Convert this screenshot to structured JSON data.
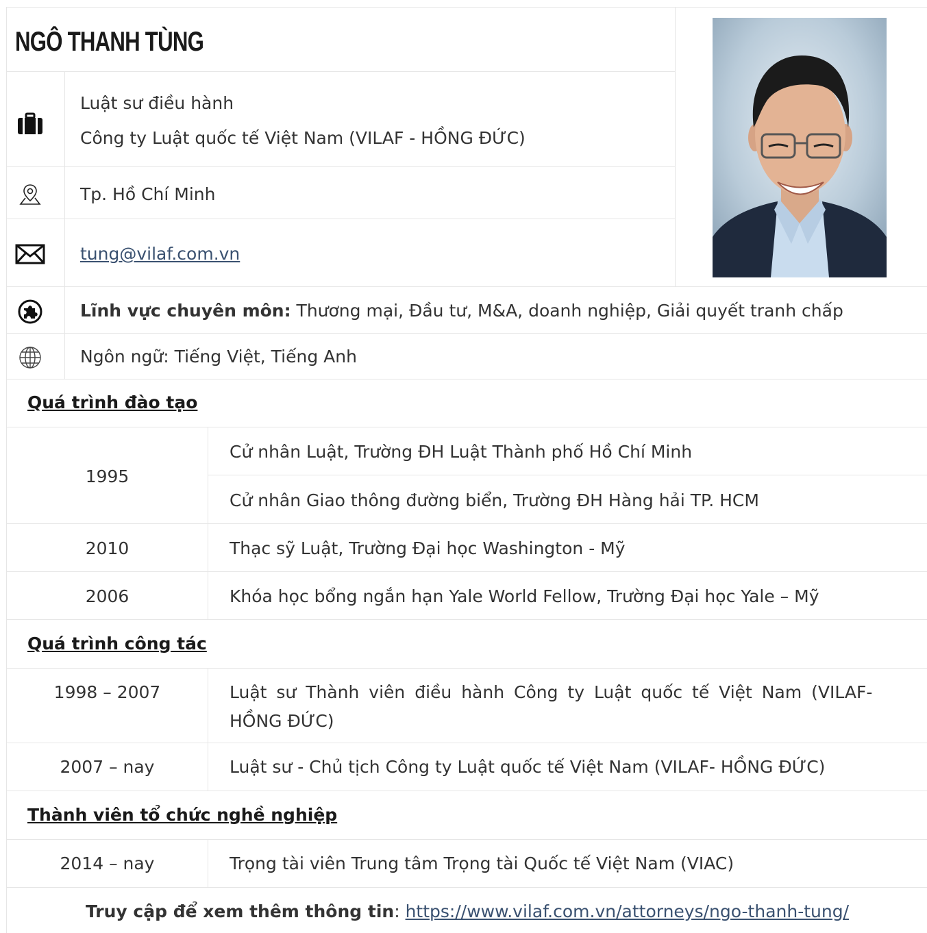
{
  "profile": {
    "name": "NGÔ THANH TÙNG",
    "position": "Luật sư điều hành",
    "company": "Công ty Luật quốc tế Việt Nam (VILAF - HỒNG ĐỨC)",
    "location": "Tp. Hồ Chí Minh",
    "email": "tung@vilaf.com.vn",
    "expertise_label": "Lĩnh vực chuyên môn:",
    "expertise_value": " Thương mại, Đầu tư, M&A, doanh nghiệp, Giải quyết tranh chấp",
    "languages": "Ngôn ngữ: Tiếng Việt, Tiếng Anh"
  },
  "icons": {
    "briefcase": "briefcase-icon",
    "location": "location-pin-icon",
    "email": "envelope-icon",
    "expertise": "puzzle-icon",
    "language": "globe-icon"
  },
  "education": {
    "title": "Quá trình đào tạo",
    "rows": [
      {
        "year": "1995",
        "items": [
          "Cử nhân Luật, Trường ĐH Luật Thành phố Hồ Chí Minh",
          "Cử nhân Giao thông đường biển, Trường ĐH Hàng hải TP. HCM"
        ]
      },
      {
        "year": "2010",
        "items": [
          "Thạc sỹ Luật, Trường Đại học Washington - Mỹ"
        ]
      },
      {
        "year": "2006",
        "items": [
          "Khóa học bổng ngắn hạn Yale World Fellow, Trường Đại học Yale – Mỹ"
        ]
      }
    ]
  },
  "work": {
    "title": "Quá trình công tác",
    "rows": [
      {
        "year": "1998 – 2007",
        "line1": "Luật sư Thành viên điều hành Công ty Luật quốc tế Việt Nam (VILAF-",
        "line2": "HỒNG ĐỨC)"
      },
      {
        "year": "2007 – nay",
        "line1": "Luật sư - Chủ tịch Công ty Luật quốc tế Việt Nam (VILAF- HỒNG ĐỨC)"
      }
    ]
  },
  "membership": {
    "title": "Thành viên tổ chức nghề nghiệp",
    "rows": [
      {
        "year": "2014 – nay",
        "text": "Trọng tài viên Trung tâm Trọng tài Quốc tế Việt Nam (VIAC)"
      }
    ]
  },
  "footer": {
    "label": "Truy cập để xem thêm thông tin",
    "separator": ": ",
    "url": "https://www.vilaf.com.vn/attorneys/ngo-thanh-tung/"
  }
}
